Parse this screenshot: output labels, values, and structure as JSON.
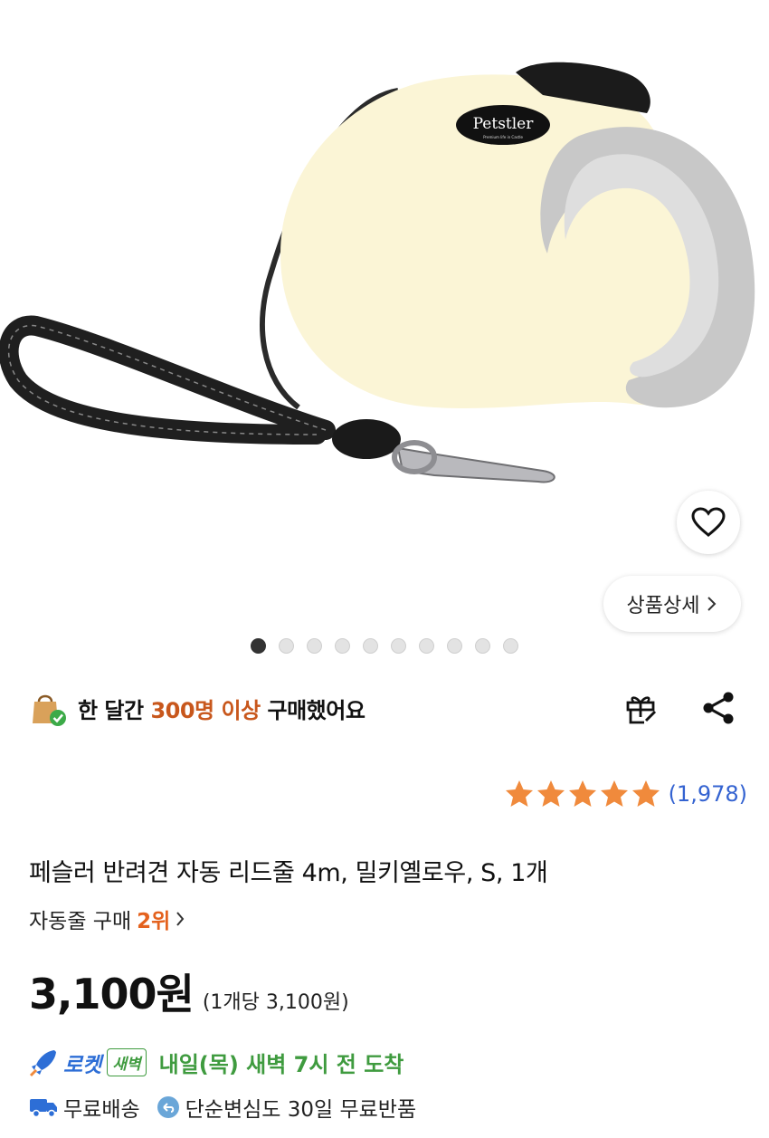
{
  "product_image": {
    "logo_text": "Petstler",
    "logo_sub": "Premium life in Castle"
  },
  "hero": {
    "detail_label": "상품상세",
    "dots_total": 10,
    "dots_active_index": 0
  },
  "purchase_notice": {
    "prefix": "한 달간 ",
    "highlight": "300명 이상",
    "suffix": " 구매했어요"
  },
  "rating": {
    "stars": 5,
    "count": "(1,978)"
  },
  "product": {
    "title": "페슬러 반려견 자동 리드줄 4m, 밀키옐로우, S, 1개",
    "rank_prefix": "자동줄 구매",
    "rank_num": "2위"
  },
  "price": {
    "main": "3,100원",
    "unit": "(1개당 3,100원)"
  },
  "delivery": {
    "rocket_label": "로켓",
    "dawn_badge": "새벽",
    "arrival": "내일(목) 새벽 7시 전 도착",
    "free_shipping": "무료배송",
    "free_return": "단순변심도 30일 무료반품"
  },
  "colors": {
    "highlight_orange": "#c8571c",
    "rank_orange": "#e4621e",
    "rating_blue": "#3463d1",
    "delivery_green": "#3f9b3f",
    "rocket_blue": "#2d6ed6"
  }
}
